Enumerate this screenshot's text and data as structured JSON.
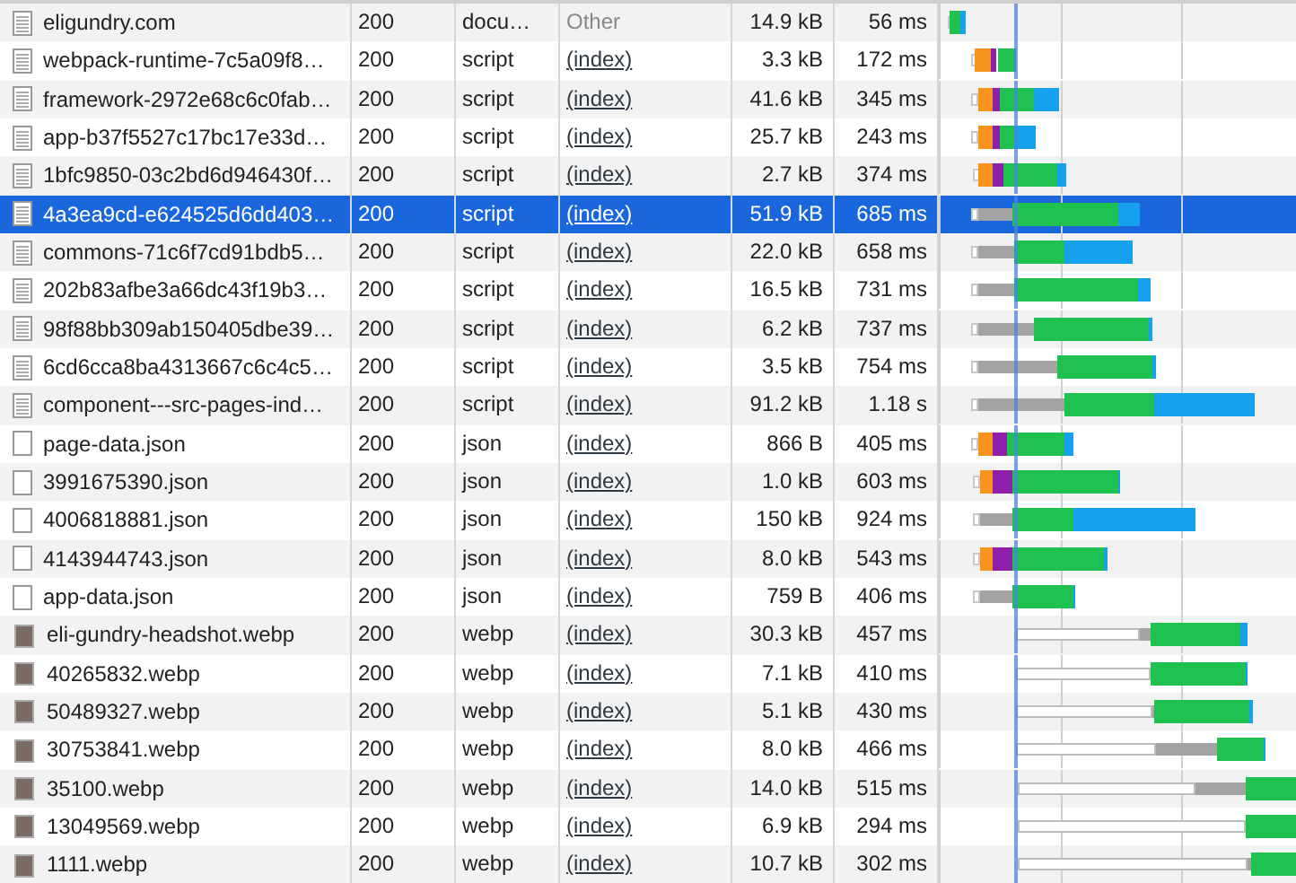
{
  "requests": [
    {
      "name": "eligundry.com",
      "status": "200",
      "type": "docu…",
      "initiator": "Other",
      "initiator_link": false,
      "size": "14.9 kB",
      "time": "56 ms",
      "kind": "document",
      "selected": false
    },
    {
      "name": "webpack-runtime-7c5a09f8…",
      "status": "200",
      "type": "script",
      "initiator": "(index)",
      "initiator_link": true,
      "size": "3.3 kB",
      "time": "172 ms",
      "kind": "document",
      "selected": false
    },
    {
      "name": "framework-2972e68c6c0fab…",
      "status": "200",
      "type": "script",
      "initiator": "(index)",
      "initiator_link": true,
      "size": "41.6 kB",
      "time": "345 ms",
      "kind": "document",
      "selected": false
    },
    {
      "name": "app-b37f5527c17bc17e33d…",
      "status": "200",
      "type": "script",
      "initiator": "(index)",
      "initiator_link": true,
      "size": "25.7 kB",
      "time": "243 ms",
      "kind": "document",
      "selected": false
    },
    {
      "name": "1bfc9850-03c2bd6d946430f…",
      "status": "200",
      "type": "script",
      "initiator": "(index)",
      "initiator_link": true,
      "size": "2.7 kB",
      "time": "374 ms",
      "kind": "document",
      "selected": false
    },
    {
      "name": "4a3ea9cd-e624525d6dd403…",
      "status": "200",
      "type": "script",
      "initiator": "(index)",
      "initiator_link": true,
      "size": "51.9 kB",
      "time": "685 ms",
      "kind": "document",
      "selected": true
    },
    {
      "name": "commons-71c6f7cd91bdb5…",
      "status": "200",
      "type": "script",
      "initiator": "(index)",
      "initiator_link": true,
      "size": "22.0 kB",
      "time": "658 ms",
      "kind": "document",
      "selected": false
    },
    {
      "name": "202b83afbe3a66dc43f19b3…",
      "status": "200",
      "type": "script",
      "initiator": "(index)",
      "initiator_link": true,
      "size": "16.5 kB",
      "time": "731 ms",
      "kind": "document",
      "selected": false
    },
    {
      "name": "98f88bb309ab150405dbe39…",
      "status": "200",
      "type": "script",
      "initiator": "(index)",
      "initiator_link": true,
      "size": "6.2 kB",
      "time": "737 ms",
      "kind": "document",
      "selected": false
    },
    {
      "name": "6cd6cca8ba4313667c6c4c5…",
      "status": "200",
      "type": "script",
      "initiator": "(index)",
      "initiator_link": true,
      "size": "3.5 kB",
      "time": "754 ms",
      "kind": "document",
      "selected": false
    },
    {
      "name": "component---src-pages-ind…",
      "status": "200",
      "type": "script",
      "initiator": "(index)",
      "initiator_link": true,
      "size": "91.2 kB",
      "time": "1.18 s",
      "kind": "document",
      "selected": false
    },
    {
      "name": "page-data.json",
      "status": "200",
      "type": "json",
      "initiator": "(index)",
      "initiator_link": true,
      "size": "866 B",
      "time": "405 ms",
      "kind": "blank",
      "selected": false
    },
    {
      "name": "3991675390.json",
      "status": "200",
      "type": "json",
      "initiator": "(index)",
      "initiator_link": true,
      "size": "1.0 kB",
      "time": "603 ms",
      "kind": "blank",
      "selected": false
    },
    {
      "name": "4006818881.json",
      "status": "200",
      "type": "json",
      "initiator": "(index)",
      "initiator_link": true,
      "size": "150 kB",
      "time": "924 ms",
      "kind": "blank",
      "selected": false
    },
    {
      "name": "4143944743.json",
      "status": "200",
      "type": "json",
      "initiator": "(index)",
      "initiator_link": true,
      "size": "8.0 kB",
      "time": "543 ms",
      "kind": "blank",
      "selected": false
    },
    {
      "name": "app-data.json",
      "status": "200",
      "type": "json",
      "initiator": "(index)",
      "initiator_link": true,
      "size": "759 B",
      "time": "406 ms",
      "kind": "blank",
      "selected": false
    },
    {
      "name": "eli-gundry-headshot.webp",
      "status": "200",
      "type": "webp",
      "initiator": "(index)",
      "initiator_link": true,
      "size": "30.3 kB",
      "time": "457 ms",
      "kind": "image",
      "selected": false
    },
    {
      "name": "40265832.webp",
      "status": "200",
      "type": "webp",
      "initiator": "(index)",
      "initiator_link": true,
      "size": "7.1 kB",
      "time": "410 ms",
      "kind": "image",
      "selected": false
    },
    {
      "name": "50489327.webp",
      "status": "200",
      "type": "webp",
      "initiator": "(index)",
      "initiator_link": true,
      "size": "5.1 kB",
      "time": "430 ms",
      "kind": "image",
      "selected": false
    },
    {
      "name": "30753841.webp",
      "status": "200",
      "type": "webp",
      "initiator": "(index)",
      "initiator_link": true,
      "size": "8.0 kB",
      "time": "466 ms",
      "kind": "image",
      "selected": false
    },
    {
      "name": "35100.webp",
      "status": "200",
      "type": "webp",
      "initiator": "(index)",
      "initiator_link": true,
      "size": "14.0 kB",
      "time": "515 ms",
      "kind": "image",
      "selected": false
    },
    {
      "name": "13049569.webp",
      "status": "200",
      "type": "webp",
      "initiator": "(index)",
      "initiator_link": true,
      "size": "6.9 kB",
      "time": "294 ms",
      "kind": "image",
      "selected": false
    },
    {
      "name": "1111.webp",
      "status": "200",
      "type": "webp",
      "initiator": "(index)",
      "initiator_link": true,
      "size": "10.7 kB",
      "time": "302 ms",
      "kind": "image",
      "selected": false
    }
  ]
}
